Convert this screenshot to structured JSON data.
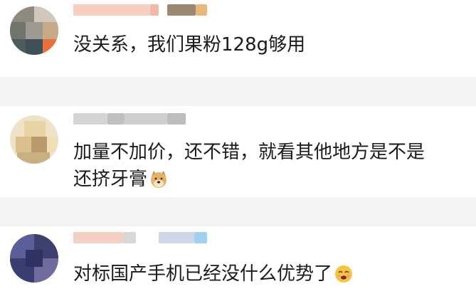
{
  "comments": [
    {
      "text": "没关系，我们果粉128g够用",
      "avatar_icon": "pixelated-avatar-icon",
      "username_icon": "blurred-username-icon"
    },
    {
      "text_line1": "加量不加价，还不错，就看其他地方是不是",
      "text_line2": "还挤牙膏",
      "avatar_icon": "pixelated-avatar-icon",
      "username_icon": "blurred-username-icon",
      "emoji_icon": "doge-emoji-icon"
    },
    {
      "text": "对标国产手机已经没什么优势了",
      "avatar_icon": "pixelated-avatar-icon",
      "username_icon": "blurred-username-icon",
      "emoji_icon": "drooling-face-emoji-icon"
    }
  ],
  "colors": {
    "background": "#f4f4f4",
    "card": "#ffffff",
    "text": "#1b1b1b"
  }
}
